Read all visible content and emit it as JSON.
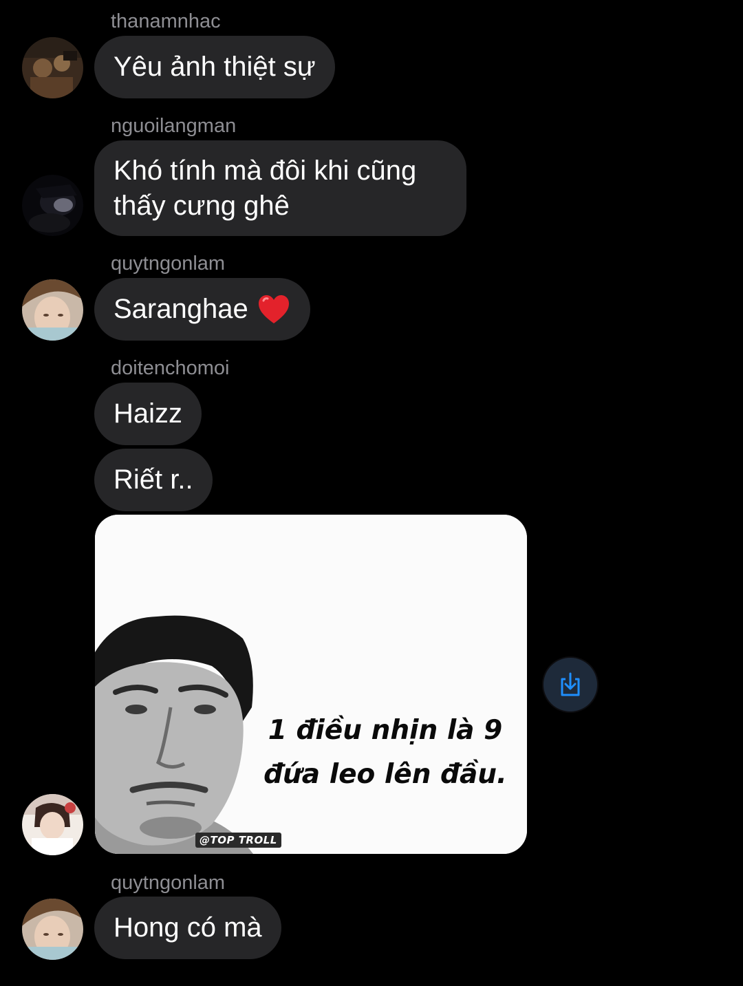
{
  "colors": {
    "background": "#000000",
    "bubble": "#262628",
    "sender_text": "#8e8e93",
    "message_text": "#ffffff",
    "accent": "#1f8fff"
  },
  "messages": [
    {
      "sender": "thanamnhac",
      "text": "Yêu ảnh thiệt sự"
    },
    {
      "sender": "nguoilangman",
      "text": "Khó tính mà đôi khi cũng thấy cưng ghê"
    },
    {
      "sender": "quytngonlam",
      "text": "Saranghae",
      "emoji": "red-heart"
    },
    {
      "sender": "doitenchomoi",
      "texts": [
        "Haizz",
        "Riết r.."
      ]
    },
    {
      "sender": "quytngonlam",
      "text": "Hong có mà"
    }
  ],
  "meme": {
    "caption": "1 điều nhịn là 9\nđứa leo lên đầu.",
    "watermark": "@TOP TROLL"
  },
  "share_icon": "share-download-icon"
}
